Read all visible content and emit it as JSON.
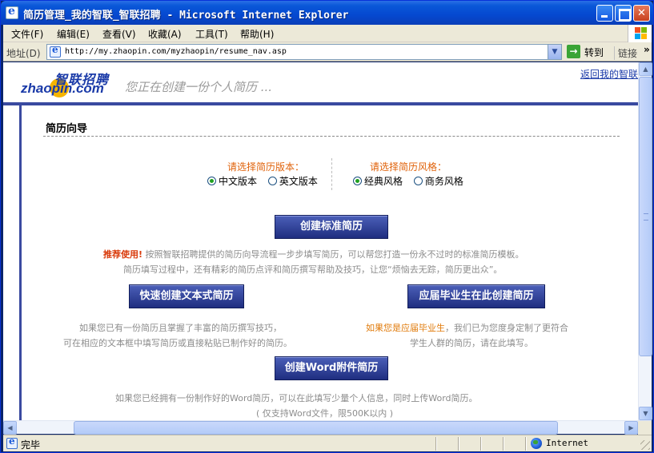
{
  "window": {
    "title": "简历管理_我的智联_智联招聘 - Microsoft Internet Explorer"
  },
  "menu": [
    "文件(F)",
    "编辑(E)",
    "查看(V)",
    "收藏(A)",
    "工具(T)",
    "帮助(H)"
  ],
  "address": {
    "label": "地址(D)",
    "url": "http://my.zhaopin.com/myzhaopin/resume_nav.asp",
    "go_label": "转到",
    "links_label": "链接",
    "links_chevron": "»"
  },
  "status": {
    "text": "完毕",
    "zone": "Internet"
  },
  "site": {
    "logo_cn": "智联招聘",
    "logo_en_left": "zha",
    "logo_en_mid": "o",
    "logo_en_right": "pin.com",
    "slogan": "您正在创建一份个人简历 ...",
    "return_link": "返回我的智联"
  },
  "wizard": {
    "title": "简历向导",
    "version": {
      "heading": "请选择简历版本：",
      "options": [
        {
          "label": "中文版本",
          "selected": true
        },
        {
          "label": "英文版本",
          "selected": false
        }
      ]
    },
    "style": {
      "heading": "请选择简历风格：",
      "options": [
        {
          "label": "经典风格",
          "selected": true
        },
        {
          "label": "商务风格",
          "selected": false
        }
      ]
    },
    "standard": {
      "button": "创建标准简历",
      "recommend": "推荐使用!",
      "desc_line1": "按照智联招聘提供的简历向导流程一步步填写简历，可以帮您打造一份永不过时的标准简历模板。",
      "desc_line2": "简历填写过程中，还有精彩的简历点评和简历撰写帮助及技巧，让您“烦恼去无踪，简历更出众”。"
    },
    "text_resume": {
      "button": "快速创建文本式简历",
      "desc_line1": "如果您已有一份简历且掌握了丰富的简历撰写技巧，",
      "desc_line2": "可在相应的文本框中填写简历或直接粘贴已制作好的简历。"
    },
    "graduate": {
      "button": "应届毕业生在此创建简历",
      "highlight": "如果您是应届毕业生",
      "desc_line1": "，我们已为您度身定制了更符合",
      "desc_line2": "学生人群的简历，请在此填写。"
    },
    "word": {
      "button": "创建Word附件简历",
      "desc_line1": "如果您已经拥有一份制作好的Word简历，可以在此填写少量个人信息，同时上传Word简历。",
      "desc_line2": "( 仅支持Word文件，限500K以内 )"
    }
  }
}
